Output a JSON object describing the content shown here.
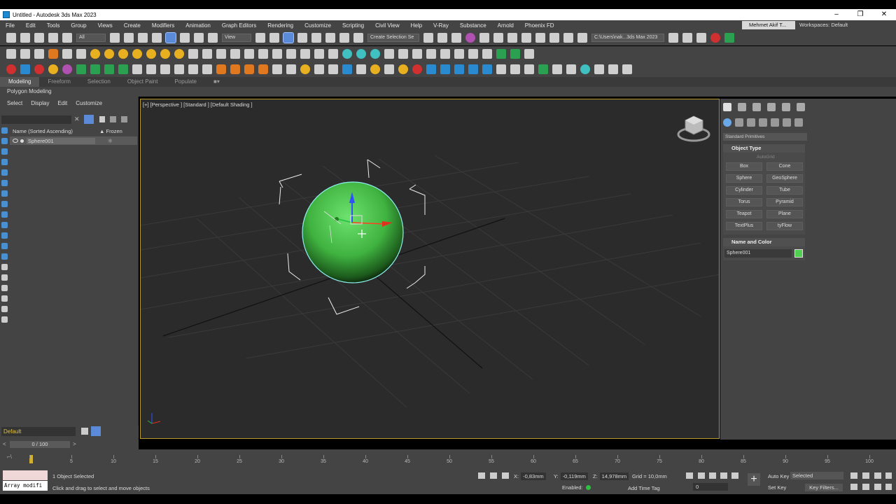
{
  "window": {
    "title": "Untitled - Autodesk 3ds Max 2023",
    "minimize": "–",
    "restore": "❐",
    "close": "✕"
  },
  "menu": {
    "items": [
      "File",
      "Edit",
      "Tools",
      "Group",
      "Views",
      "Create",
      "Modifiers",
      "Animation",
      "Graph Editors",
      "Rendering",
      "Customize",
      "Scripting",
      "Civil View",
      "Help",
      "V-Ray",
      "Substance",
      "Arnold",
      "Phoenix FD"
    ],
    "user": "Mehmet Akif T...",
    "workspaces_label": "Workspaces:",
    "workspace": "Default"
  },
  "toolbar": {
    "filter_dd": "All",
    "view_dd": "View",
    "selection_set": "Create Selection Se",
    "project_path": "C:\\Users\\nak...3ds Max 2023"
  },
  "ribbon": {
    "tabs": [
      "Modeling",
      "Freeform",
      "Selection",
      "Object Paint",
      "Populate"
    ],
    "active_tab": "Modeling",
    "sub": "Polygon Modeling"
  },
  "scene_explorer": {
    "menu": [
      "Select",
      "Display",
      "Edit",
      "Customize"
    ],
    "col_name": "Name (Sorted Ascending)",
    "col_frozen": "▲ Frozen",
    "rows": [
      {
        "name": "Sphere001"
      }
    ],
    "layer": "Default",
    "time_slider": "0 / 100"
  },
  "viewport": {
    "label": "[+] [Perspective ] [Standard ] [Default Shading ]",
    "object_color": "#50d050"
  },
  "command_panel": {
    "category_dd": "Standard Primitives",
    "object_type_title": "Object Type",
    "autogrid": "AutoGrid",
    "buttons": [
      "Box",
      "Cone",
      "Sphere",
      "GeoSphere",
      "Cylinder",
      "Tube",
      "Torus",
      "Pyramid",
      "Teapot",
      "Plane",
      "TextPlus",
      "tyFlow"
    ],
    "name_color_title": "Name and Color",
    "object_name": "Sphere001",
    "object_color": "#50d050"
  },
  "timeline": {
    "ticks": [
      "0",
      "5",
      "10",
      "15",
      "20",
      "25",
      "30",
      "35",
      "40",
      "45",
      "50",
      "55",
      "60",
      "65",
      "70",
      "75",
      "80",
      "85",
      "90",
      "95",
      "100"
    ]
  },
  "status": {
    "maxscript_input": "Array modifi",
    "selected": "1 Object Selected",
    "prompt": "Click and drag to select and move objects",
    "x_label": "X:",
    "x": "-0,83mm",
    "y_label": "Y:",
    "y": "-0,119mm",
    "z_label": "Z:",
    "z": "14,978mm",
    "grid": "Grid = 10,0mm",
    "enabled": "Enabled:",
    "add_time_tag": "Add Time Tag",
    "auto_key": "Auto Key",
    "set_key": "Set Key",
    "selected_dd": "Selected",
    "key_filters": "Key Filters...",
    "frame": "0"
  }
}
